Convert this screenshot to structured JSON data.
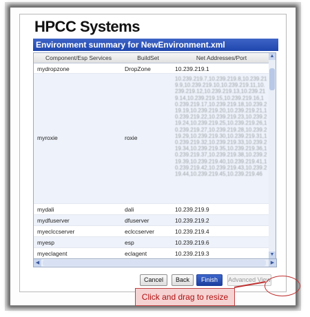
{
  "app": {
    "logo": "HPCC Systems"
  },
  "dialog": {
    "title": "Environment summary for NewEnvironment.xml"
  },
  "table": {
    "headers": [
      "Component/Esp Services",
      "BuildSet",
      "Net Addresses/Port"
    ],
    "rows": [
      {
        "component": "mydropzone",
        "buildset": "DropZone",
        "address": "10.239.219.1"
      },
      {
        "component": "myroxie",
        "buildset": "roxie",
        "address": "10.239.219.7,10.239.219.8,10.239.219.9,10.239.219.10,10.239.219.11,10.239.219.12,10.239.219.13,10.239.219.14,10.239.219.15,10.239.219.16,10.239.219.17,10.239.219.18,10.239.219.19,10.239.219.20,10.239.219.21,10.239.219.22,10.239.219.23,10.239.219.24,10.239.219.25,10.239.219.26,10.239.219.27,10.239.219.28,10.239.219.29,10.239.219.30,10.239.219.31,10.239.219.32,10.239.219.33,10.239.219.34,10.239.219.35,10.239.219.36,10.239.219.37,10.239.219.38,10.239.219.39,10.239.219.40,10.239.219.41,10.239.219.42,10.239.219.43,10.239.219.44,10.239.219.45,10.239.219.46"
      },
      {
        "component": "mydali",
        "buildset": "dali",
        "address": "10.239.219.9"
      },
      {
        "component": "mydfuserver",
        "buildset": "dfuserver",
        "address": "10.239.219.2"
      },
      {
        "component": "myeclccserver",
        "buildset": "eclccserver",
        "address": "10.239.219.4"
      },
      {
        "component": "myesp",
        "buildset": "esp",
        "address": "10.239.219.6"
      },
      {
        "component": "myeclagent",
        "buildset": "eclagent",
        "address": "10.239.219.3"
      }
    ]
  },
  "buttons": {
    "cancel": "Cancel",
    "back": "Back",
    "finish": "Finish",
    "advanced": "Advanced View"
  },
  "annotation": {
    "callout": "Click and drag to resize",
    "accent": "#c03030"
  },
  "colors": {
    "titlebar": "#2a50b8",
    "primary": "#1c3f9e"
  }
}
